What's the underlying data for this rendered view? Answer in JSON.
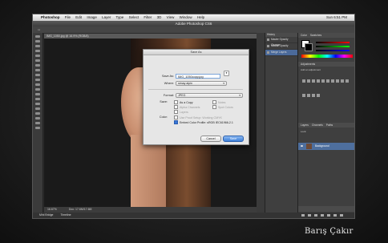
{
  "menubar": {
    "apple": "",
    "items": [
      "Photoshop",
      "File",
      "Edit",
      "Image",
      "Layer",
      "Type",
      "Select",
      "Filter",
      "3D",
      "View",
      "Window",
      "Help"
    ],
    "clock": "Sun 6:51 PM"
  },
  "app_title": "Adobe Photoshop CS6",
  "document": {
    "tab_title": "IMG_1050.jpg @ 16.9% (RGB/8)",
    "zoom": "16.67%",
    "doc_info": "Doc: 17.6M/17.6M"
  },
  "bottom_tabs": {
    "mini_bridge": "Mini Bridge",
    "timeline": "Timeline"
  },
  "history_panel": {
    "header": "History",
    "items": [
      "Master Opacity Change",
      "Master Opacity Change",
      "Merge Layers"
    ],
    "selected_index": 2
  },
  "right_panel": {
    "tabs": [
      "Color",
      "Swatches"
    ],
    "adjustments_header": "Adjustments",
    "adjustments_label": "Add an adjustment",
    "layers_tabs": [
      "Layers",
      "Channels",
      "Paths"
    ],
    "layers_controls": "Lock:",
    "layer_name": "Background"
  },
  "dialog": {
    "title": "Save As",
    "save_as_label": "Save As:",
    "save_as_value": "IMG_1050copy.jpg",
    "where_label": "Where:",
    "where_value": "simay alpin",
    "format_label": "Format:",
    "format_value": "JPEG",
    "save_label": "Save:",
    "options": [
      {
        "label": "As a Copy",
        "checked": false,
        "enabled": true
      },
      {
        "label": "Notes",
        "checked": false,
        "enabled": false
      },
      {
        "label": "Alpha Channels",
        "checked": false,
        "enabled": false
      },
      {
        "label": "Spot Colors",
        "checked": false,
        "enabled": false
      },
      {
        "label": "Layers",
        "checked": false,
        "enabled": false
      }
    ],
    "color_label": "Color:",
    "use_proof": "Use Proof Setup:  Working CMYK",
    "embed_profile": "Embed Color Profile:  sRGB IEC61966-2.1",
    "cancel": "Cancel",
    "save": "Save"
  },
  "signature": "Barış Çakır",
  "colors": {
    "selection": "#4b6a9a",
    "primary_button": "#3d7fd8"
  }
}
